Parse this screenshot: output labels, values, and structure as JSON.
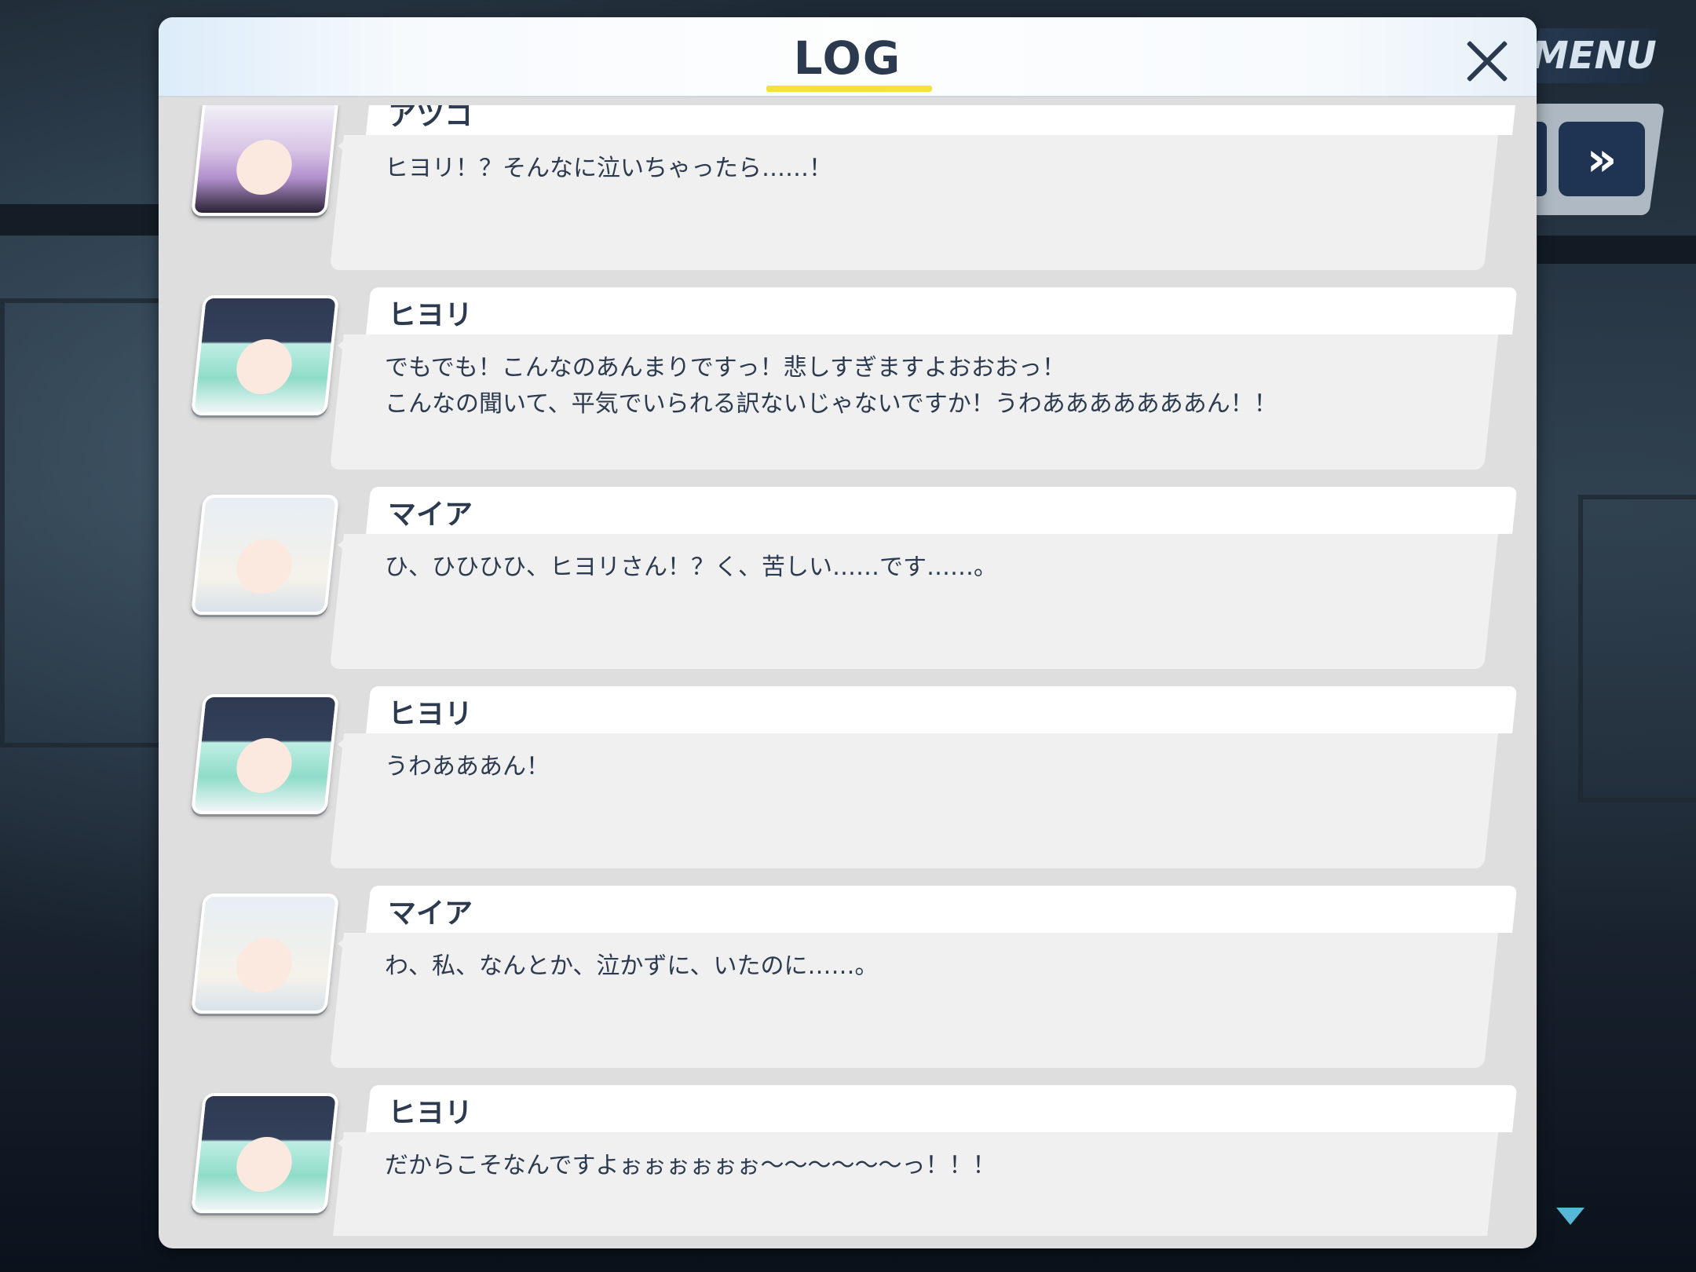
{
  "header": {
    "title": "LOG"
  },
  "menu": {
    "label": "MENU",
    "fast_forward_glyph": "»"
  },
  "entries": [
    {
      "speaker": "アツコ",
      "avatar": "avatar-atsuko",
      "text": "ヒヨリ！？そんなに泣いちゃったら……！"
    },
    {
      "speaker": "ヒヨリ",
      "avatar": "avatar-hiyori",
      "text": "でもでも！こんなのあんまりですっ！悲しすぎますよおおおっ！\nこんなの聞いて、平気でいられる訳ないじゃないですか！うわあああああああん！！"
    },
    {
      "speaker": "マイア",
      "avatar": "avatar-maia",
      "text": "ひ、ひひひひ、ヒヨリさん！？く、苦しい……です……。"
    },
    {
      "speaker": "ヒヨリ",
      "avatar": "avatar-hiyori",
      "text": "うわあああん！"
    },
    {
      "speaker": "マイア",
      "avatar": "avatar-maia",
      "text": "わ、私、なんとか、泣かずに、いたのに……。"
    },
    {
      "speaker": "ヒヨリ",
      "avatar": "avatar-hiyori",
      "text": "だからこそなんですよぉぉぉぉぉぉ〜〜〜〜〜〜っ！！！"
    }
  ]
}
